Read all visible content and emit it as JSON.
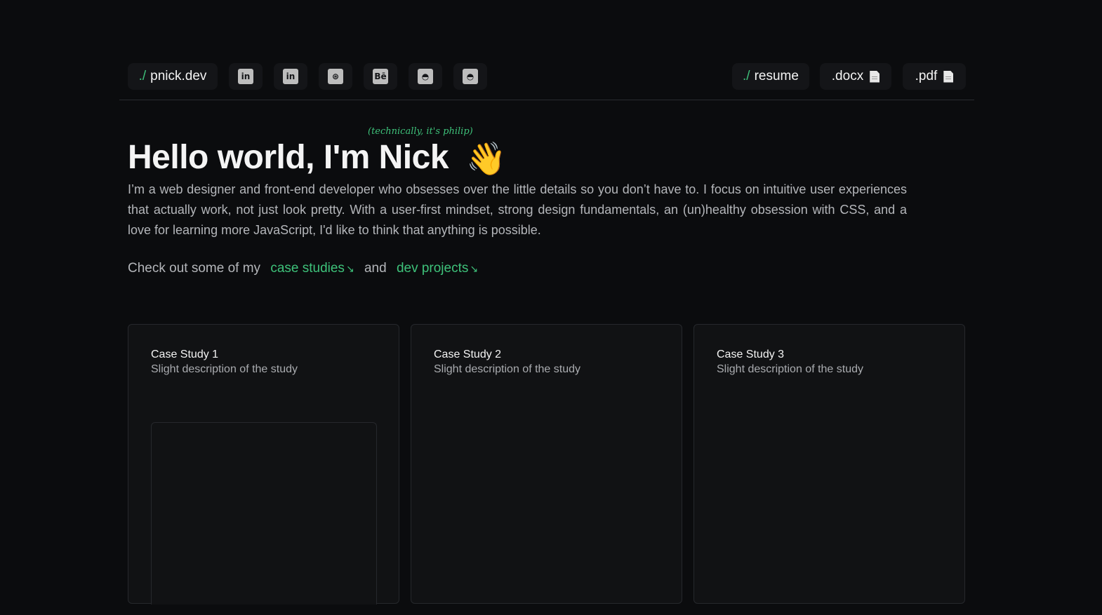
{
  "nav": {
    "brand_prefix": "./",
    "brand_label": "pnick.dev",
    "socials": [
      {
        "icon": "linkedin-icon",
        "glyph": "in"
      },
      {
        "icon": "linkedin-icon",
        "glyph": "in"
      },
      {
        "icon": "dribbble-icon",
        "glyph": "⊛"
      },
      {
        "icon": "behance-icon",
        "glyph": "Bē"
      },
      {
        "icon": "github-icon",
        "glyph": "◓"
      },
      {
        "icon": "github-icon",
        "glyph": "◓"
      }
    ],
    "resume_prefix": "./",
    "resume_label": "resume",
    "docx_label": ".docx",
    "pdf_label": ".pdf"
  },
  "hero": {
    "aside": "(technically, it's philip)",
    "title": "Hello world, I'm Nick",
    "emoji": "👋",
    "intro": "I’m a web designer and front-end developer who obsesses over the little details so you don’t have to. I focus on intuitive user experiences that actually work, not just look pretty. With a user-first mindset, strong design fundamentals, an (un)healthy obsession with CSS, and a love for learning more JavaScript, I'd like to think that anything is possible.",
    "cta_prefix": "Check out some of my",
    "cta_link1": "case studies",
    "cta_joiner": "and",
    "cta_link2": "dev projects",
    "cta_arrow": "↘"
  },
  "cards": [
    {
      "title": "Case Study 1",
      "desc": "Slight description of the study"
    },
    {
      "title": "Case Study 2",
      "desc": "Slight description of the study"
    },
    {
      "title": "Case Study 3",
      "desc": "Slight description of the study"
    }
  ],
  "colors": {
    "background": "#0b0c0e",
    "accent": "#3ec27a",
    "card": "#111214"
  }
}
